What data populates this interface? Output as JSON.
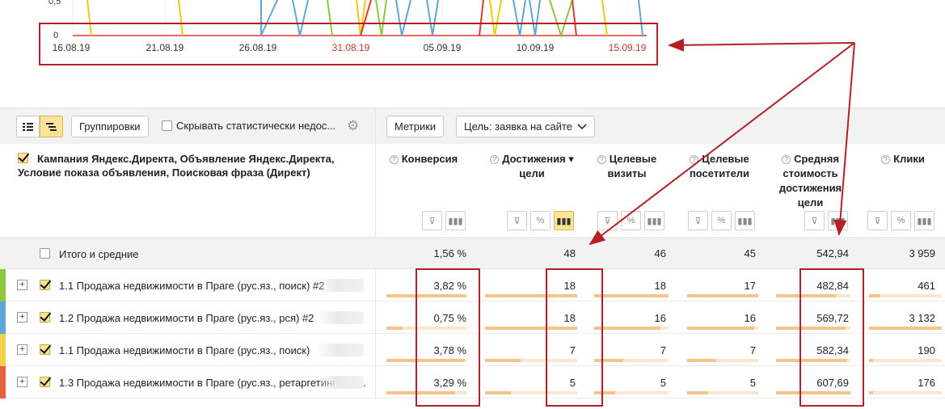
{
  "chart": {
    "y_ticks": [
      "0,5",
      "0"
    ],
    "x_ticks": [
      {
        "label": "16.08.19",
        "weekend": false
      },
      {
        "label": "21.08.19",
        "weekend": false
      },
      {
        "label": "26.08.19",
        "weekend": false
      },
      {
        "label": "31.08.19",
        "weekend": true
      },
      {
        "label": "05.09.19",
        "weekend": false
      },
      {
        "label": "10.09.19",
        "weekend": false
      },
      {
        "label": "15.09.19",
        "weekend": true
      }
    ],
    "series_colors": [
      "#f2c811",
      "#5ea6da",
      "#8dc63f",
      "#e4382a"
    ]
  },
  "toolbar": {
    "groupings_label": "Группировки",
    "hide_stat_label": "Скрывать статистически недос...",
    "metrics_label": "Метрики",
    "goal_label": "Цель: заявка на сайте"
  },
  "table": {
    "dimension_title": "Кампания Яндекс.Директа, Объявление Яндекс.Директа, Условие показа объявления, Поисковая фраза (Директ)",
    "columns": [
      {
        "key": "conv",
        "label": "Конверсия"
      },
      {
        "key": "goals",
        "label": "Достижения ▾ цели"
      },
      {
        "key": "visits",
        "label": "Целевые визиты"
      },
      {
        "key": "visitors",
        "label": "Целевые посетители"
      },
      {
        "key": "cost",
        "label": "Средняя стоимость достижения цели"
      },
      {
        "key": "clicks",
        "label": "Клики"
      }
    ],
    "totals": {
      "label": "Итого и средние",
      "conv": "1,56 %",
      "goals": "48",
      "visits": "46",
      "visitors": "45",
      "cost": "542,94",
      "clicks": "3 959"
    },
    "rows": [
      {
        "color": "#8dc63f",
        "name": "1.1 Продажа недвижимости в Праге (рус.яз., поиск) #2",
        "conv": "3,82 %",
        "goals": "18",
        "visits": "18",
        "visitors": "17",
        "cost": "482,84",
        "clicks": "461",
        "bars": {
          "conv": 0.98,
          "goals": 1.0,
          "visits": 1.0,
          "visitors": 1.0,
          "cost": 0.8,
          "clicks": 0.15
        }
      },
      {
        "color": "#5ea6da",
        "name": "1.2 Продажа недвижимости в Праге (рус.яз., рся) #2",
        "conv": "0,75 %",
        "goals": "18",
        "visits": "16",
        "visitors": "16",
        "cost": "569,72",
        "clicks": "3 132",
        "bars": {
          "conv": 0.2,
          "goals": 1.0,
          "visits": 0.89,
          "visitors": 0.94,
          "cost": 0.94,
          "clicks": 1.0
        }
      },
      {
        "color": "#f2d04a",
        "name": "1.1 Продажа недвижимости в Праге (рус.яз., поиск)",
        "conv": "3,78 %",
        "goals": "7",
        "visits": "7",
        "visitors": "7",
        "cost": "582,34",
        "clicks": "190",
        "bars": {
          "conv": 0.97,
          "goals": 0.39,
          "visits": 0.39,
          "visitors": 0.41,
          "cost": 0.96,
          "clicks": 0.06
        }
      },
      {
        "color": "#e8613d",
        "name": "1.3 Продажа недвижимости в Праге (рус.яз., ретаргетинг) #2 ...",
        "conv": "3,29 %",
        "goals": "5",
        "visits": "5",
        "visitors": "5",
        "cost": "607,69",
        "clicks": "176",
        "bars": {
          "conv": 0.85,
          "goals": 0.28,
          "visits": 0.28,
          "visitors": 0.29,
          "cost": 1.0,
          "clicks": 0.06
        }
      }
    ]
  }
}
